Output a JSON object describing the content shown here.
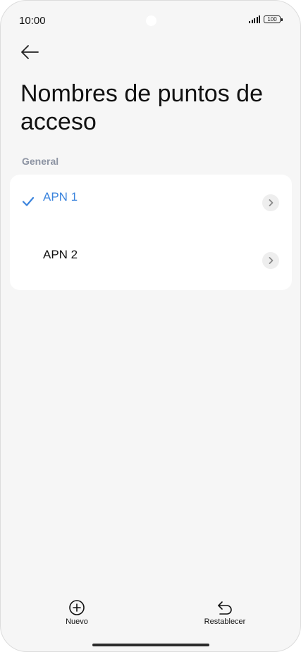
{
  "status_bar": {
    "time": "10:00",
    "battery": "100"
  },
  "header": {
    "back_icon": "arrow-left-icon",
    "title": "Nombres de puntos de acceso"
  },
  "section": {
    "label": "General"
  },
  "apn_list": [
    {
      "label": "APN 1",
      "selected": true
    },
    {
      "label": "APN 2",
      "selected": false
    }
  ],
  "bottom_bar": {
    "new_label": "Nuevo",
    "new_icon": "plus-circle-icon",
    "reset_label": "Restablecer",
    "reset_icon": "undo-icon"
  },
  "colors": {
    "accent": "#3b84dd",
    "background": "#f6f6f6",
    "card": "#ffffff",
    "section_label": "#8d94a3"
  }
}
